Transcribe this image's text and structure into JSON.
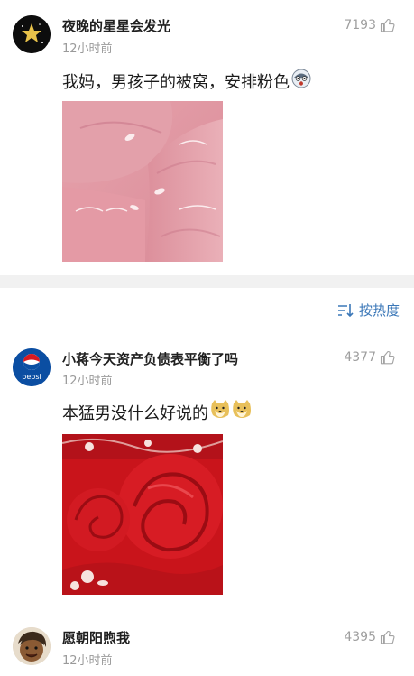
{
  "comments": [
    {
      "username": "夜晚的星星会发光",
      "time": "12小时前",
      "likes": "7193",
      "text": "我妈，男孩子的被窝，安排粉色",
      "avatar": "star-avatar",
      "emoji": "shocked-face-emoji",
      "image": "pink-bedding-photo"
    },
    {
      "username": "小蒋今天资产负债表平衡了吗",
      "time": "12小时前",
      "likes": "4377",
      "text": "本猛男没什么好说的",
      "avatar": "pepsi-logo-avatar",
      "emoji": "doge-emoji",
      "image": "red-rose-bedding-photo"
    },
    {
      "username": "愿朝阳煦我",
      "time": "12小时前",
      "likes": "4395",
      "avatar": "cartoon-face-avatar"
    }
  ],
  "sort": {
    "label": "按热度",
    "icon": "sort-icon"
  },
  "avatar_logo_text": "pepsi",
  "colors": {
    "link_blue": "#3c78b8",
    "meta_gray": "#9a9a9a",
    "pink_bedding": "#e29aa5",
    "red_bedding": "#d4191e"
  }
}
